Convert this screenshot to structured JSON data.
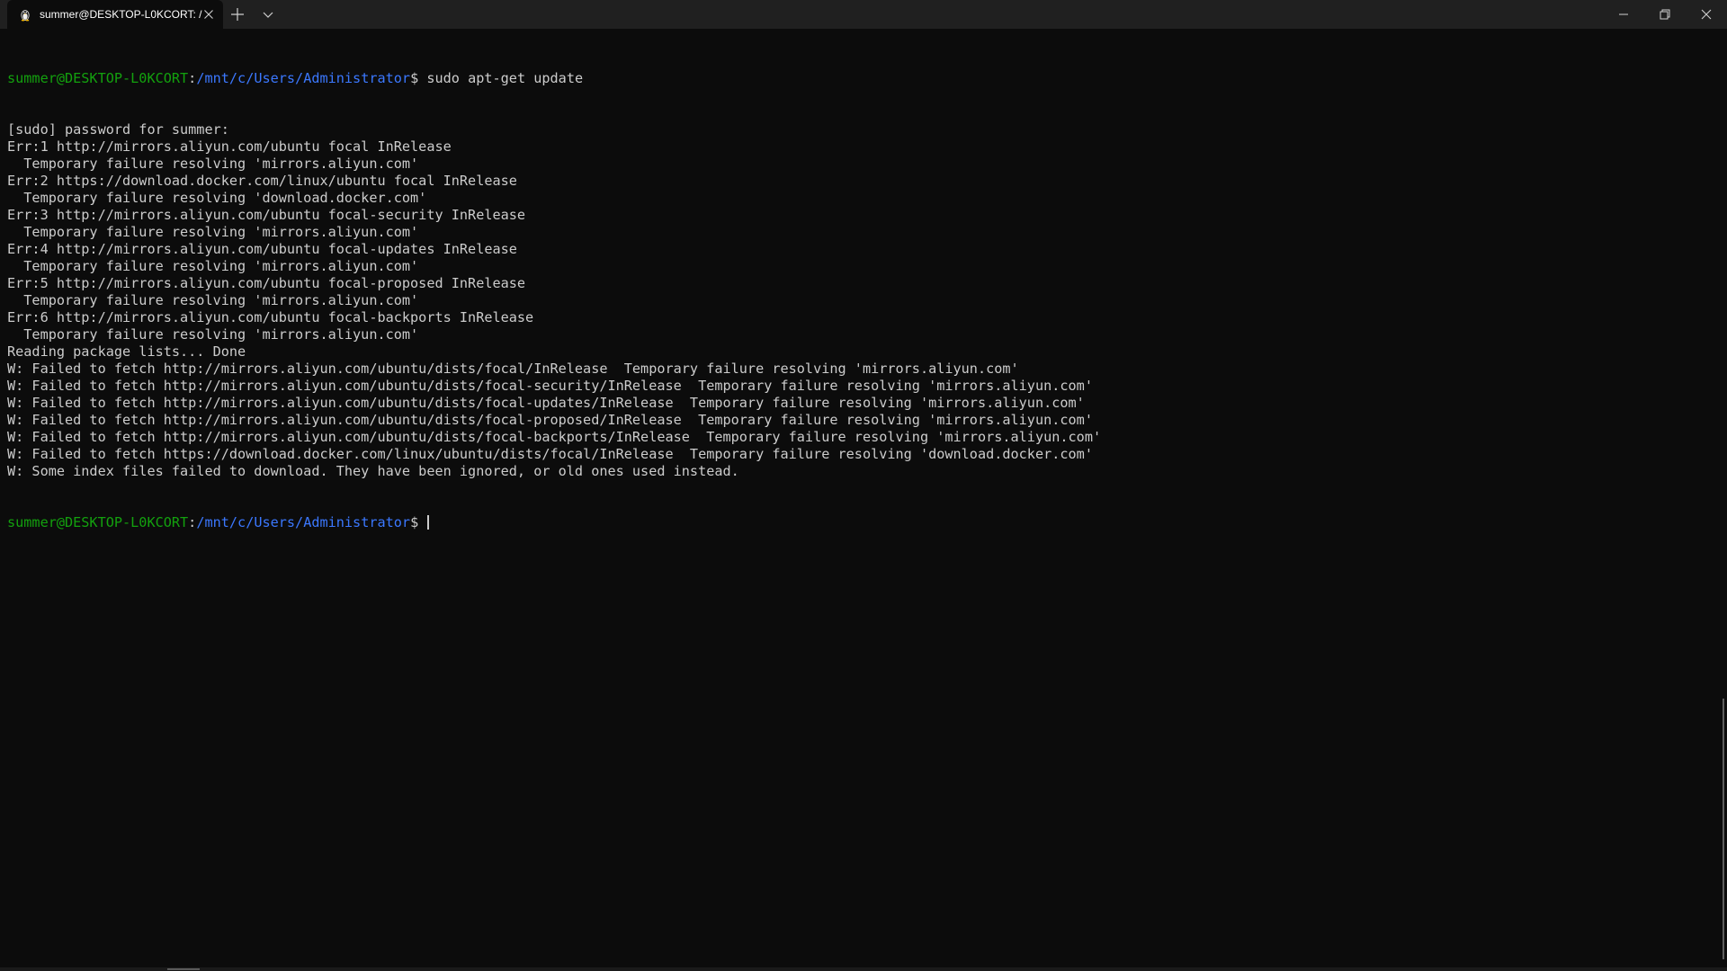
{
  "window": {
    "tab_title": "summer@DESKTOP-L0KCORT: /",
    "tab_icon": "linux-penguin-icon",
    "buttons": {
      "close_tab": "close-icon",
      "new_tab": "plus-icon",
      "dropdown": "chevron-down-icon",
      "minimize": "minimize-icon",
      "maximize": "restore-icon",
      "close_window": "close-icon"
    }
  },
  "colors": {
    "background": "#0c0c0c",
    "foreground": "#cccccc",
    "prompt_user": "#13a10e",
    "prompt_path": "#3b78ff",
    "titlebar": "#202020"
  },
  "terminal": {
    "prompt_user": "summer@DESKTOP-L0KCORT",
    "prompt_sep": ":",
    "prompt_path": "/mnt/c/Users/Administrator",
    "prompt_symbol": "$ ",
    "command": "sudo apt-get update",
    "output": [
      "[sudo] password for summer:",
      "Err:1 http://mirrors.aliyun.com/ubuntu focal InRelease",
      "  Temporary failure resolving 'mirrors.aliyun.com'",
      "Err:2 https://download.docker.com/linux/ubuntu focal InRelease",
      "  Temporary failure resolving 'download.docker.com'",
      "Err:3 http://mirrors.aliyun.com/ubuntu focal-security InRelease",
      "  Temporary failure resolving 'mirrors.aliyun.com'",
      "Err:4 http://mirrors.aliyun.com/ubuntu focal-updates InRelease",
      "  Temporary failure resolving 'mirrors.aliyun.com'",
      "Err:5 http://mirrors.aliyun.com/ubuntu focal-proposed InRelease",
      "  Temporary failure resolving 'mirrors.aliyun.com'",
      "Err:6 http://mirrors.aliyun.com/ubuntu focal-backports InRelease",
      "  Temporary failure resolving 'mirrors.aliyun.com'",
      "Reading package lists... Done",
      "W: Failed to fetch http://mirrors.aliyun.com/ubuntu/dists/focal/InRelease  Temporary failure resolving 'mirrors.aliyun.com'",
      "W: Failed to fetch http://mirrors.aliyun.com/ubuntu/dists/focal-security/InRelease  Temporary failure resolving 'mirrors.aliyun.com'",
      "W: Failed to fetch http://mirrors.aliyun.com/ubuntu/dists/focal-updates/InRelease  Temporary failure resolving 'mirrors.aliyun.com'",
      "W: Failed to fetch http://mirrors.aliyun.com/ubuntu/dists/focal-proposed/InRelease  Temporary failure resolving 'mirrors.aliyun.com'",
      "W: Failed to fetch http://mirrors.aliyun.com/ubuntu/dists/focal-backports/InRelease  Temporary failure resolving 'mirrors.aliyun.com'",
      "W: Failed to fetch https://download.docker.com/linux/ubuntu/dists/focal/InRelease  Temporary failure resolving 'download.docker.com'",
      "W: Some index files failed to download. They have been ignored, or old ones used instead."
    ]
  }
}
